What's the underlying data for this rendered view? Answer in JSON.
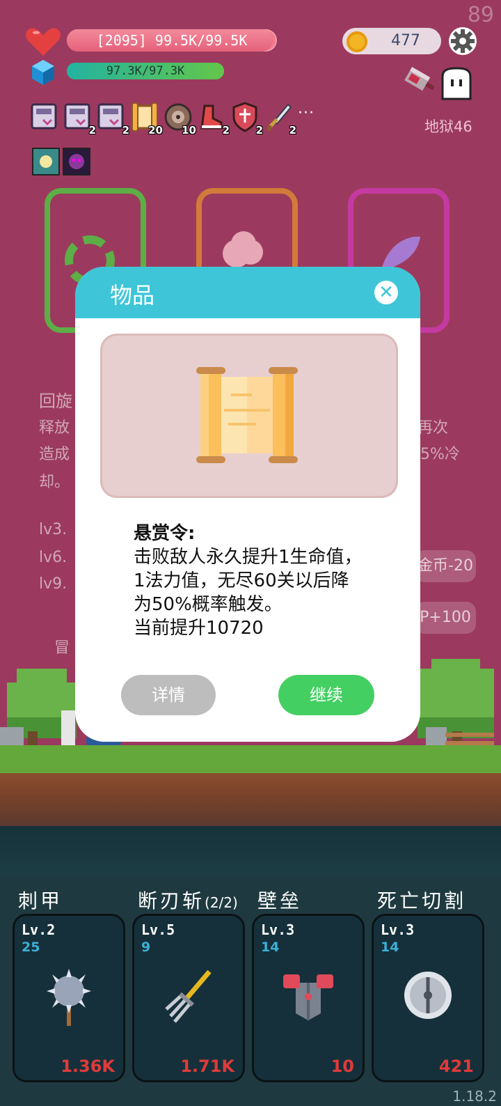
{
  "hud": {
    "fps": "89",
    "hp_text": "[2095] 99.5K/99.5K",
    "hp_fraction": 0.98,
    "mp_text": "97.3K/97.3K",
    "mp_fraction": 1.0,
    "coins": "477",
    "stage": "地狱46",
    "more": "···"
  },
  "items": [
    {
      "icon": "card-icon",
      "count": ""
    },
    {
      "icon": "card-icon",
      "count": "2"
    },
    {
      "icon": "card-icon",
      "count": "2"
    },
    {
      "icon": "scroll-icon",
      "count": "20"
    },
    {
      "icon": "shield-disc-icon",
      "count": "10"
    },
    {
      "icon": "boot-icon",
      "count": "2"
    },
    {
      "icon": "shield-icon",
      "count": "2"
    },
    {
      "icon": "sword-icon",
      "count": "2"
    }
  ],
  "background": {
    "skill_title": "回旋",
    "line1a": "释放",
    "line1b": "再次",
    "line2a": "造成",
    "line2b": "5%冷",
    "line3": "却。",
    "lv3": "lv3.",
    "lv6": "lv6.",
    "lv9": "lv9.",
    "pill1": "金币-20",
    "pill2": "P+100",
    "adventure": "冒"
  },
  "dialog": {
    "title": "物品",
    "close": "✕",
    "label": "悬赏令:",
    "text": "击败敌人永久提升1生命值，1法力值，无尽60关以后降为50%概率触发。",
    "current": "当前提升10720",
    "detail_button": "详情",
    "continue_button": "继续"
  },
  "skills": [
    {
      "name": "刺甲",
      "extra": "",
      "level": "Lv.2",
      "num": "25",
      "cost": "1.36K",
      "icon": "spiked-mace-icon"
    },
    {
      "name": "断刃斩",
      "extra": "(2/2)",
      "level": "Lv.5",
      "num": "9",
      "cost": "1.71K",
      "icon": "pitchfork-icon"
    },
    {
      "name": "壁垒",
      "extra": "",
      "level": "Lv.3",
      "num": "14",
      "cost": "10",
      "icon": "armor-icon"
    },
    {
      "name": "死亡切割",
      "extra": "",
      "level": "Lv.3",
      "num": "14",
      "cost": "421",
      "icon": "sawblade-icon"
    }
  ],
  "version": "1.18.2",
  "colors": {
    "background": "#9b3a5e",
    "dialog_header": "#3ec6d8",
    "continue": "#44cf62",
    "detail": "#bdbdbd",
    "cost": "#e03a3a"
  }
}
